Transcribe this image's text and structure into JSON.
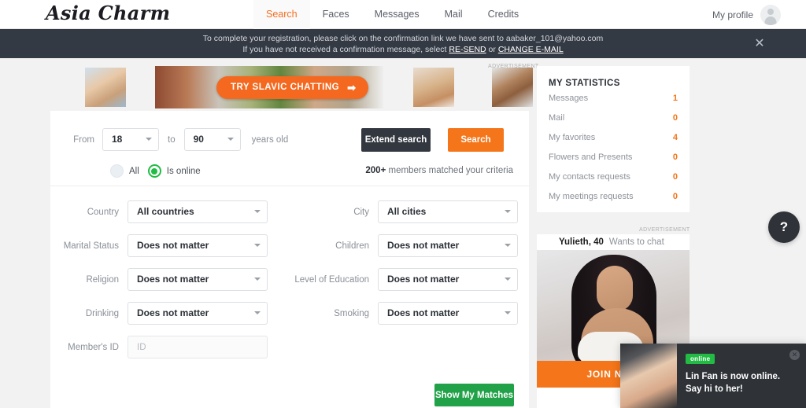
{
  "header": {
    "logo": "Asia Charm",
    "nav": [
      {
        "label": "Search",
        "active": true
      },
      {
        "label": "Faces",
        "active": false
      },
      {
        "label": "Messages",
        "active": false
      },
      {
        "label": "Mail",
        "active": false
      },
      {
        "label": "Credits",
        "active": false
      }
    ],
    "profile_label": "My profile"
  },
  "notice": {
    "line1": "To complete your registration, please click on the confirmation link we have sent to aabaker_101@yahoo.com",
    "line2_prefix": "If you have not received a confirmation message, select ",
    "link_resend": "RE-SEND",
    "line2_or": " or ",
    "link_change": "CHANGE E-MAIL",
    "close": "✕"
  },
  "banner": {
    "cta_label": "TRY SLAVIC CHATTING",
    "cta_arrow": "➡",
    "ad_label": "ADVERTISEMENT"
  },
  "search": {
    "from_label": "From",
    "age_from": "18",
    "to_label": "to",
    "age_to": "90",
    "years_label": "years old",
    "extend_label": "Extend search",
    "search_label": "Search",
    "radio_all": "All",
    "radio_online": "Is online",
    "match_count": "200+",
    "match_text": "members matched your criteria",
    "show_matches_label": "Show My Matches",
    "fields": [
      {
        "label": "Country",
        "value": "All countries",
        "type": "select"
      },
      {
        "label": "City",
        "value": "All cities",
        "type": "select"
      },
      {
        "label": "Marital Status",
        "value": "Does not matter",
        "type": "select"
      },
      {
        "label": "Children",
        "value": "Does not matter",
        "type": "select"
      },
      {
        "label": "Religion",
        "value": "Does not matter",
        "type": "select"
      },
      {
        "label": "Level of Education",
        "value": "Does not matter",
        "type": "select"
      },
      {
        "label": "Drinking",
        "value": "Does not matter",
        "type": "select"
      },
      {
        "label": "Smoking",
        "value": "Does not matter",
        "type": "select"
      },
      {
        "label": "Member's ID",
        "value": "",
        "placeholder": "ID",
        "type": "input"
      }
    ]
  },
  "statistics": {
    "title": "MY STATISTICS",
    "rows": [
      {
        "label": "Messages",
        "value": "1"
      },
      {
        "label": "Mail",
        "value": "0"
      },
      {
        "label": "My favorites",
        "value": "4"
      },
      {
        "label": "Flowers and Presents",
        "value": "0"
      },
      {
        "label": "My contacts requests",
        "value": "0"
      },
      {
        "label": "My meetings requests",
        "value": "0"
      }
    ]
  },
  "promo": {
    "ad_label": "ADVERTISEMENT",
    "name": "Yulieth, 40",
    "subtitle": "Wants to chat",
    "join_label": "JOIN NOW"
  },
  "help": {
    "label": "?"
  },
  "toast": {
    "badge": "online",
    "message": "Lin Fan is now online. Say hi to her!",
    "close": "✕"
  },
  "colors": {
    "accent_orange": "#f4751a",
    "dark": "#333840",
    "green": "#21a148",
    "online_green": "#22bb44",
    "notice_bg": "#343a44",
    "page_bg": "#f2f2f2"
  }
}
